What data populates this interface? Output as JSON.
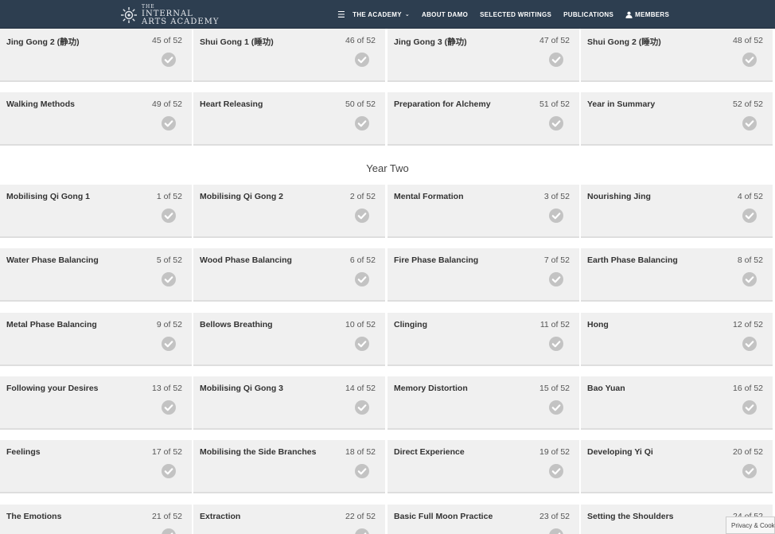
{
  "header": {
    "logo": {
      "line1": "THE",
      "line2": "INTERNAL",
      "line3": "ARTS ACADEMY"
    },
    "nav": [
      {
        "label": "THE ACADEMY",
        "has_dropdown": true
      },
      {
        "label": "ABOUT DAMO"
      },
      {
        "label": "SELECTED WRITINGS"
      },
      {
        "label": "PUBLICATIONS"
      },
      {
        "label": "MEMBERS",
        "icon": "user-icon"
      }
    ],
    "menu_icon": "☰"
  },
  "year_one_cards": [
    {
      "title": "Jing Gong 2 (静功)",
      "count": "45 of 52"
    },
    {
      "title": "Shui Gong 1 (睡功)",
      "count": "46 of 52"
    },
    {
      "title": "Jing Gong 3 (静功)",
      "count": "47 of 52"
    },
    {
      "title": "Shui Gong 2 (睡功)",
      "count": "48 of 52"
    },
    {
      "title": "Walking Methods",
      "count": "49 of 52"
    },
    {
      "title": "Heart Releasing",
      "count": "50 of 52"
    },
    {
      "title": "Preparation for Alchemy",
      "count": "51 of 52"
    },
    {
      "title": "Year in Summary",
      "count": "52 of 52"
    }
  ],
  "section_heading": "Year Two",
  "year_two_cards": [
    {
      "title": "Mobilising Qi Gong 1",
      "count": "1 of 52"
    },
    {
      "title": "Mobilising Qi Gong 2",
      "count": "2 of 52"
    },
    {
      "title": "Mental Formation",
      "count": "3 of 52"
    },
    {
      "title": "Nourishing Jing",
      "count": "4 of 52"
    },
    {
      "title": "Water Phase Balancing",
      "count": "5 of 52"
    },
    {
      "title": "Wood Phase Balancing",
      "count": "6 of 52"
    },
    {
      "title": "Fire Phase Balancing",
      "count": "7 of 52"
    },
    {
      "title": "Earth Phase Balancing",
      "count": "8 of 52"
    },
    {
      "title": "Metal Phase Balancing",
      "count": "9 of 52"
    },
    {
      "title": "Bellows Breathing",
      "count": "10 of 52"
    },
    {
      "title": "Clinging",
      "count": "11 of 52"
    },
    {
      "title": "Hong",
      "count": "12 of 52"
    },
    {
      "title": "Following your Desires",
      "count": "13 of 52"
    },
    {
      "title": "Mobilising Qi Gong 3",
      "count": "14 of 52"
    },
    {
      "title": "Memory Distortion",
      "count": "15 of 52"
    },
    {
      "title": "Bao Yuan",
      "count": "16 of 52"
    },
    {
      "title": "Feelings",
      "count": "17 of 52"
    },
    {
      "title": "Mobilising the Side Branches",
      "count": "18 of 52"
    },
    {
      "title": "Direct Experience",
      "count": "19 of 52"
    },
    {
      "title": "Developing Yi Qi",
      "count": "20 of 52"
    },
    {
      "title": "The Emotions",
      "count": "21 of 52"
    },
    {
      "title": "Extraction",
      "count": "22 of 52"
    },
    {
      "title": "Basic Full Moon Practice",
      "count": "23 of 52"
    },
    {
      "title": "Setting the Shoulders",
      "count": "24 of 52"
    }
  ],
  "privacy_label": "Privacy & Cookies",
  "colors": {
    "header_bg": "#2d3e50",
    "card_bg": "#f0f0f0",
    "check_circle": "#c3c3c3"
  }
}
